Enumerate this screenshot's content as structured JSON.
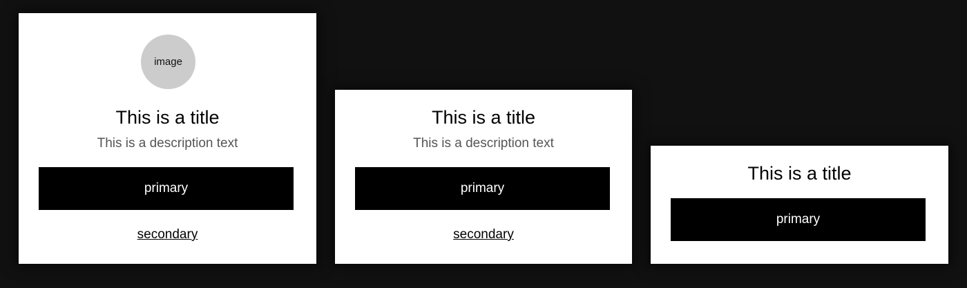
{
  "cards": [
    {
      "image_label": "image",
      "title": "This is a title",
      "description": "This is a description text",
      "primary_label": "primary",
      "secondary_label": "secondary"
    },
    {
      "title": "This is a title",
      "description": "This is a description text",
      "primary_label": "primary",
      "secondary_label": "secondary"
    },
    {
      "title": "This is a title",
      "primary_label": "primary"
    }
  ],
  "colors": {
    "page_background": "#111111",
    "card_background": "#ffffff",
    "primary_button": "#000000",
    "image_placeholder": "#cccccc",
    "description_text": "#555555"
  }
}
